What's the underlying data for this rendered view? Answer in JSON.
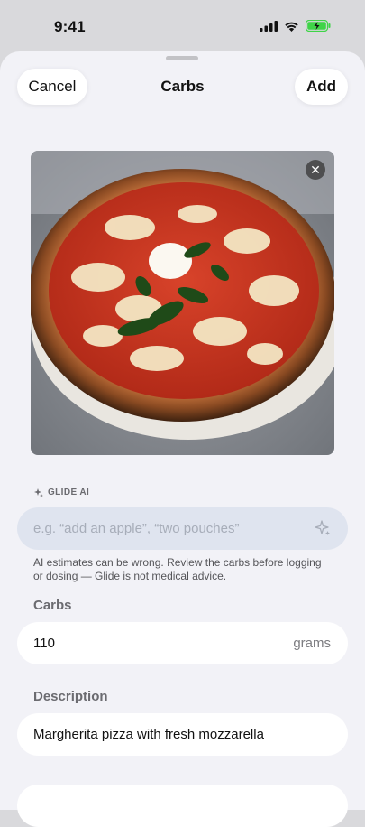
{
  "status_bar": {
    "time": "9:41",
    "icons": [
      "cellular-signal-icon",
      "wifi-icon",
      "battery-charging-icon"
    ]
  },
  "sheet": {
    "cancel_label": "Cancel",
    "title": "Carbs",
    "add_label": "Add"
  },
  "photo": {
    "subject": "margherita pizza",
    "remove_icon": "close-icon"
  },
  "ai": {
    "label": "GLIDE AI",
    "placeholder": "e.g. “add an apple”, “two pouches”",
    "disclaimer": "AI estimates can be wrong. Review the carbs before logging or dosing — Glide is not medical advice."
  },
  "carbs": {
    "label": "Carbs",
    "value": "110",
    "unit": "grams"
  },
  "description": {
    "label": "Description",
    "value": "Margherita pizza with fresh mozzarella"
  },
  "colors": {
    "accent": "#3fd448",
    "sheet_bg": "#f2f2f7",
    "ai_field_bg": "#dfe4ef"
  }
}
